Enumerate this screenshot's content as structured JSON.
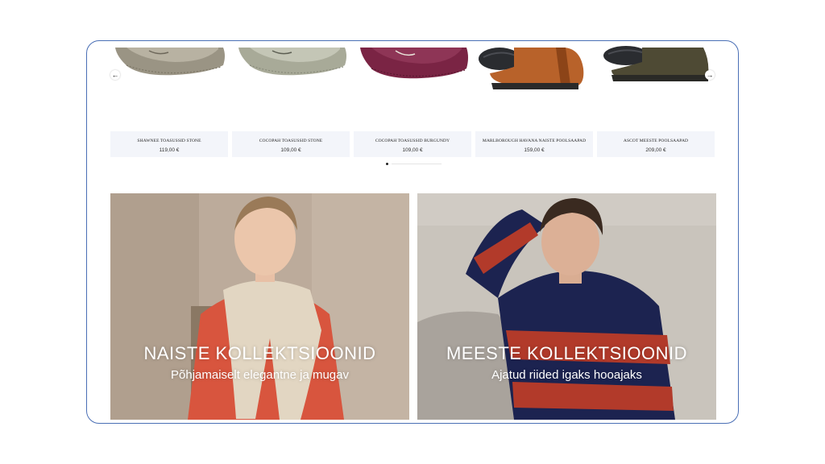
{
  "products": [
    {
      "name": "SHAWNEE TOASUSSID STONE",
      "price": "119,00 €",
      "image": "stone moccasin slipper"
    },
    {
      "name": "COCOPAH TOASUSSID STONE",
      "price": "109,00 €",
      "image": "light stone moccasin slipper"
    },
    {
      "name": "COCOPAH TOASUSSID BURGUNDY",
      "price": "109,00 €",
      "image": "burgundy moccasin slipper"
    },
    {
      "name": "MARLBOROUGH HAVANA NAISTE POOLSAAPAD",
      "price": "159,00 €",
      "image": "tan chelsea boot"
    },
    {
      "name": "ASCOT MEESTE POOLSAAPAD",
      "price": "209,00 €",
      "image": "olive suede boot"
    }
  ],
  "carousel": {
    "prev_icon": "arrow-left-icon",
    "next_icon": "arrow-right-icon",
    "prev_glyph": "←",
    "next_glyph": "→",
    "active_page": 1
  },
  "banners": {
    "women": {
      "title": "NAISTE KOLLEKTSIOONID",
      "subtitle": "Põhjamaiselt elegantne ja mugav"
    },
    "men": {
      "title": "MEESTE KOLLEKTSIOONID",
      "subtitle": "Ajatud riided igaks hooajaks"
    }
  },
  "colors": {
    "frame_border": "#4a6fb5",
    "product_info_bg": "#f3f5fa"
  }
}
